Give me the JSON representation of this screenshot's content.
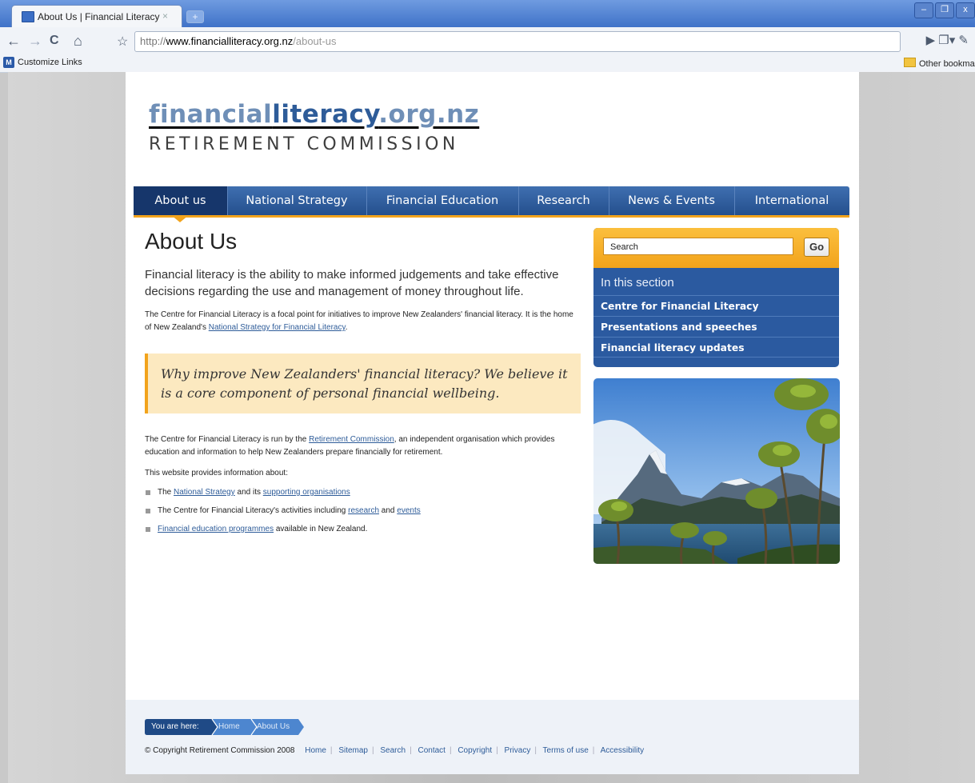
{
  "browser": {
    "tab_title": "About Us | Financial Literacy",
    "tab_close": "×",
    "newtab": "+",
    "url_scheme": "http://",
    "url_host": "www.financialliteracy.org.nz",
    "url_path": "/about-us",
    "bookmark_customize": "Customize Links",
    "bookmark_other": "Other bookmarks",
    "back_icon": "←",
    "forward_icon": "→",
    "reload_icon": "C",
    "home_icon": "⌂",
    "star_icon": "☆",
    "minimize": "–",
    "restore": "❐",
    "close": "x"
  },
  "site": {
    "logo_part1": "financial",
    "logo_part2": "literacy",
    "logo_part3": ".org.nz",
    "logo_subtitle": "RETIREMENT COMMISSION"
  },
  "nav": {
    "items": [
      {
        "label": "About us"
      },
      {
        "label": "National Strategy"
      },
      {
        "label": "Financial Education"
      },
      {
        "label": "Research"
      },
      {
        "label": "News & Events"
      },
      {
        "label": "International"
      }
    ]
  },
  "main": {
    "title": "About Us",
    "intro": "Financial literacy is the ability to make informed judgements and take effective decisions regarding the use and management of money throughout life.",
    "p1_text": "The Centre for Financial Literacy is a focal point for initiatives to improve New Zealanders' financial literacy. It is the home of New Zealand's ",
    "p1_link": "National Strategy for Financial Literacy",
    "p1_end": ".",
    "quote": "Why improve New Zealanders' financial literacy?  We believe it is a core component of personal financial wellbeing.",
    "p2_text": "The Centre for Financial Literacy is run by the ",
    "p2_link": "Retirement Commission",
    "p2_end": ", an independent organisation which provides education and information to help New Zealanders prepare financially for retirement.",
    "p3": "This website provides information about:",
    "bullet1_a": "The ",
    "bullet1_link1": "National Strategy",
    "bullet1_b": " and its ",
    "bullet1_link2": "supporting organisations",
    "bullet2_a": "The Centre for Financial Literacy's activities including ",
    "bullet2_link1": "research",
    "bullet2_b": " and ",
    "bullet2_link2": "events",
    "bullet3_link": "Financial education programmes",
    "bullet3_b": " available in New Zealand."
  },
  "sidebar": {
    "search_placeholder": "Search",
    "go_label": "Go",
    "section_title": "In this section",
    "items": [
      {
        "label": "Centre for Financial Literacy"
      },
      {
        "label": "Presentations and speeches"
      },
      {
        "label": "Financial literacy updates"
      }
    ]
  },
  "footer": {
    "you_are_here": "You are here:",
    "crumb_home": "Home",
    "crumb_current": "About Us",
    "copyright": "© Copyright Retirement Commission 2008",
    "links": [
      "Home",
      "Sitemap",
      "Search",
      "Contact",
      "Copyright",
      "Privacy",
      "Terms of use",
      "Accessibility"
    ]
  },
  "colors": {
    "nav_blue": "#244f8d",
    "accent_orange": "#f2a31b",
    "link_blue": "#2e5c99",
    "quote_bg": "#fce9c0"
  }
}
